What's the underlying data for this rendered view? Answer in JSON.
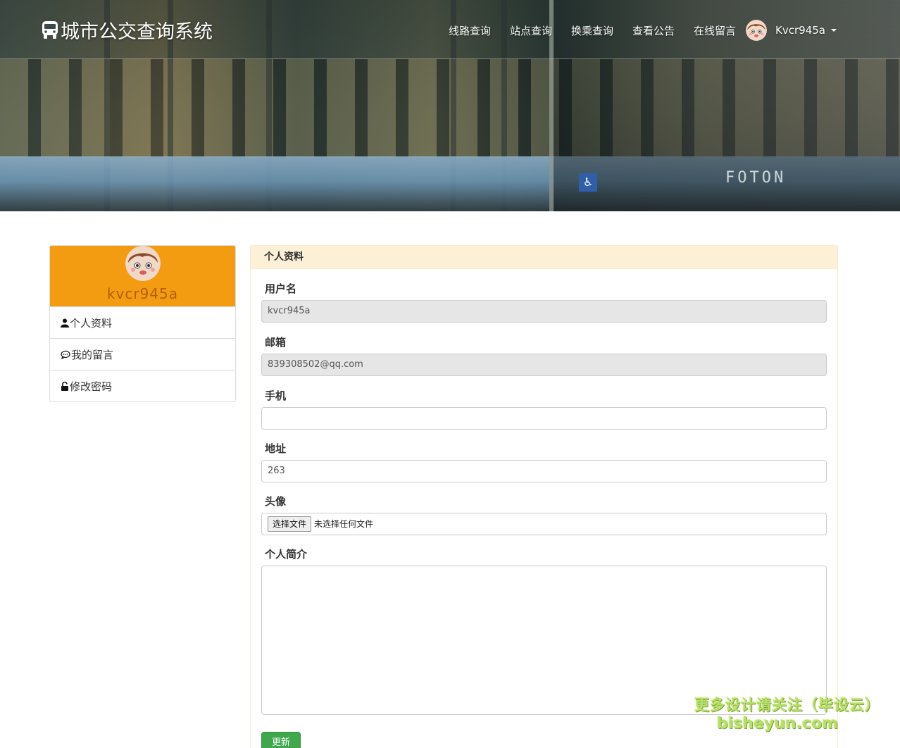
{
  "colors": {
    "accent_orange": "#f39c12",
    "panel_heading_bg": "#fcf0d7",
    "success": "#3ea84a"
  },
  "navbar": {
    "brand": "城市公交查询系统",
    "brand_icon": "bus-icon",
    "links": [
      "线路查询",
      "站点查询",
      "换乘查询",
      "查看公告",
      "在线留言"
    ],
    "user": "Kvcr945a"
  },
  "hero": {
    "bus_brand": "FOTON"
  },
  "sidebar": {
    "username": "kvcr945a",
    "items": [
      {
        "label": "个人资料",
        "icon": "user-icon"
      },
      {
        "label": "我的留言",
        "icon": "comment-icon"
      },
      {
        "label": "修改密码",
        "icon": "unlock-icon"
      }
    ]
  },
  "panel": {
    "title": "个人资料",
    "fields": {
      "username": {
        "label": "用户名",
        "value": "kvcr945a"
      },
      "email": {
        "label": "邮箱",
        "value": "839308502@qq.com"
      },
      "phone": {
        "label": "手机",
        "value": ""
      },
      "address": {
        "label": "地址",
        "value": "263"
      },
      "avatar": {
        "label": "头像",
        "button": "选择文件",
        "status": "未选择任何文件"
      },
      "bio": {
        "label": "个人简介",
        "value": ""
      }
    },
    "submit": "更新"
  },
  "watermark": {
    "line1": "更多设计请关注（毕设云）",
    "line2": "bisheyun.com"
  }
}
